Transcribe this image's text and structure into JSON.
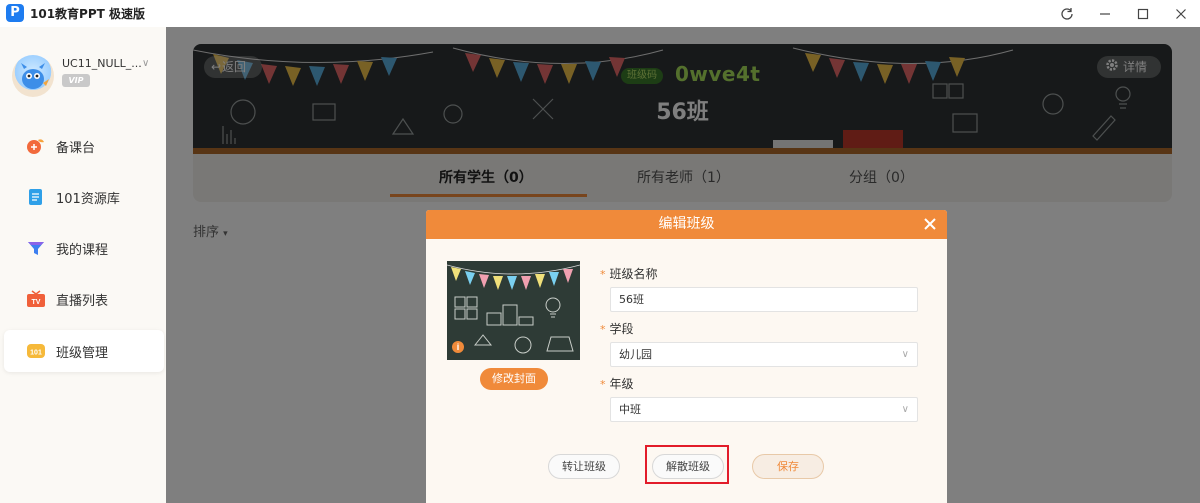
{
  "app": {
    "title": "101教育PPT 极速版"
  },
  "window_controls": [
    "refresh-icon",
    "minimize-icon",
    "maximize-icon",
    "close-icon"
  ],
  "user": {
    "name": "UC11_NULL_...",
    "badge": "VIP"
  },
  "nav": [
    {
      "label": "备课台",
      "icon": "lesson-prep-icon",
      "active": false
    },
    {
      "label": "101资源库",
      "icon": "resource-library-icon",
      "active": false
    },
    {
      "label": "我的课程",
      "icon": "my-courses-icon",
      "active": false
    },
    {
      "label": "直播列表",
      "icon": "live-tv-icon",
      "active": false
    },
    {
      "label": "班级管理",
      "icon": "class-management-icon",
      "active": true
    }
  ],
  "banner": {
    "back_label": "返回",
    "detail_label": "详情",
    "code_badge": "班级码",
    "class_code": "0wve4t",
    "class_name": "56班"
  },
  "tabs": [
    {
      "label": "所有学生（0）",
      "active": true
    },
    {
      "label": "所有老师（1）",
      "active": false
    },
    {
      "label": "分组（0）",
      "active": false
    }
  ],
  "sort_label": "排序",
  "modal": {
    "title": "编辑班级",
    "change_cover_label": "修改封面",
    "fields": [
      {
        "label": "班级名称",
        "value": "56班",
        "type": "text"
      },
      {
        "label": "学段",
        "value": "幼儿园",
        "type": "select"
      },
      {
        "label": "年级",
        "value": "中班",
        "type": "select"
      }
    ],
    "buttons": {
      "transfer": "转让班级",
      "dissolve": "解散班级",
      "save": "保存"
    }
  },
  "colors": {
    "accent": "#f08a3a",
    "highlight": "#e21c2a",
    "code_green": "#a8e05a"
  }
}
